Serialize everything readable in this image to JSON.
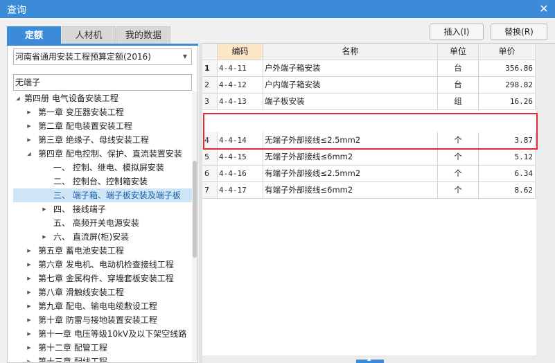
{
  "window": {
    "title": "查询"
  },
  "tabs": [
    {
      "label": "定额",
      "active": true
    },
    {
      "label": "人材机",
      "active": false
    },
    {
      "label": "我的数据",
      "active": false
    }
  ],
  "toolbar": {
    "insert_label": "插入(I)",
    "replace_label": "替换(R)"
  },
  "filter": {
    "quota_book": "河南省通用安装工程预算定额(2016)",
    "search_value": "无端子"
  },
  "tree": [
    {
      "label": "第四册 电气设备安装工程",
      "expanded": true
    },
    {
      "label": "第一章 变压器安装工程"
    },
    {
      "label": "第二章 配电装置安装工程"
    },
    {
      "label": "第三章 绝缘子、母线安装工程"
    },
    {
      "label": "第四章 配电控制、保护、直流装置安装",
      "expanded": true
    },
    {
      "label": "一、 控制、继电、模拟屏安装"
    },
    {
      "label": "二、 控制台、控制箱安装"
    },
    {
      "label": "三、 端子箱、端子板安装及端子板",
      "selected": true
    },
    {
      "label": "四、 接线端子"
    },
    {
      "label": "五、 高频开关电源安装"
    },
    {
      "label": "六、 直流屏(柜)安装"
    },
    {
      "label": "第五章 蓄电池安装工程"
    },
    {
      "label": "第六章 发电机、电动机检查接线工程"
    },
    {
      "label": "第七章 金属构件、穿墙套板安装工程"
    },
    {
      "label": "第八章 滑触线安装工程"
    },
    {
      "label": "第九章 配电、输电电缆敷设工程"
    },
    {
      "label": "第十章 防雷与接地装置安装工程"
    },
    {
      "label": "第十一章 电压等级10kV及以下架空线路"
    },
    {
      "label": "第十二章 配管工程"
    },
    {
      "label": "第十三章 配线工程"
    }
  ],
  "table": {
    "headers": {
      "code": "编码",
      "name": "名称",
      "unit": "单位",
      "price": "单价"
    },
    "rows": [
      {
        "no": "1",
        "code": "4-4-11",
        "name": "户外端子箱安装",
        "unit": "台",
        "price": "356.86"
      },
      {
        "no": "2",
        "code": "4-4-12",
        "name": "户内端子箱安装",
        "unit": "台",
        "price": "298.82"
      },
      {
        "no": "3",
        "code": "4-4-13",
        "name": "端子板安装",
        "unit": "组",
        "price": "16.26"
      },
      {
        "no": "4",
        "code": "4-4-14",
        "name": "无端子外部接线≤2.5mm2",
        "unit": "个",
        "price": "3.87"
      },
      {
        "no": "5",
        "code": "4-4-15",
        "name": "无端子外部接线≤6mm2",
        "unit": "个",
        "price": "5.12"
      },
      {
        "no": "6",
        "code": "4-4-16",
        "name": "有端子外部接线≤2.5mm2",
        "unit": "个",
        "price": "6.34"
      },
      {
        "no": "7",
        "code": "4-4-17",
        "name": "有端子外部接线≤6mm2",
        "unit": "个",
        "price": "8.62"
      }
    ]
  },
  "colors": {
    "accent": "#3c8bd9",
    "highlight": "#e8262d"
  }
}
